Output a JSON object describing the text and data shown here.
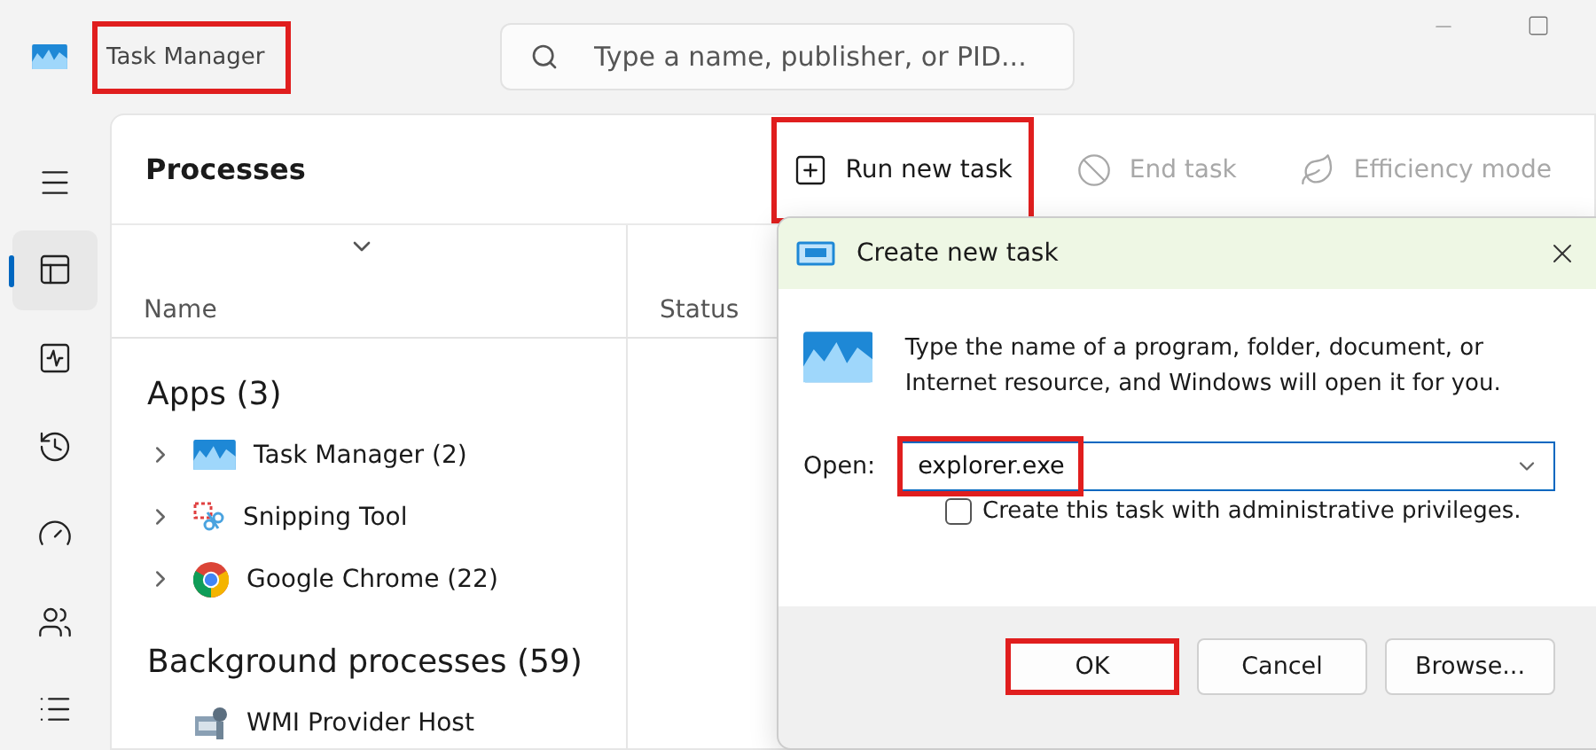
{
  "window": {
    "title": "Task Manager",
    "title_highlighted": true
  },
  "search": {
    "placeholder": "Type a name, publisher, or PID..."
  },
  "nav": [
    {
      "selected": false
    },
    {
      "selected": true
    },
    {
      "selected": false
    },
    {
      "selected": false
    },
    {
      "selected": false
    },
    {
      "selected": false
    },
    {
      "selected": false
    }
  ],
  "page_title": "Processes",
  "toolbar": [
    {
      "label": "Run new task",
      "disabled": false,
      "highlighted": true
    },
    {
      "label": "End task",
      "disabled": true,
      "highlighted": false
    },
    {
      "label": "Efficiency mode",
      "disabled": true,
      "highlighted": false
    }
  ],
  "table": {
    "columns": [
      "Name",
      "Status"
    ],
    "groups": [
      {
        "title": "Apps (3)",
        "rows": [
          {
            "name": "Task Manager (2)",
            "expandable": true
          },
          {
            "name": "Snipping Tool",
            "expandable": true
          },
          {
            "name": "Google Chrome (22)",
            "expandable": true
          }
        ]
      },
      {
        "title": "Background processes (59)",
        "rows": [
          {
            "name": "WMI Provider Host",
            "expandable": false
          }
        ]
      }
    ]
  },
  "dialog": {
    "title": "Create new task",
    "message": "Type the name of a program, folder, document, or Internet resource, and Windows will open it for you.",
    "open_label": "Open:",
    "open_value": "explorer.exe",
    "open_highlighted": true,
    "admin_checkbox": {
      "label": "Create this task with administrative privileges.",
      "checked": false
    },
    "buttons": [
      {
        "label": "OK",
        "highlighted": true
      },
      {
        "label": "Cancel",
        "highlighted": false
      },
      {
        "label": "Browse...",
        "highlighted": false
      }
    ]
  }
}
